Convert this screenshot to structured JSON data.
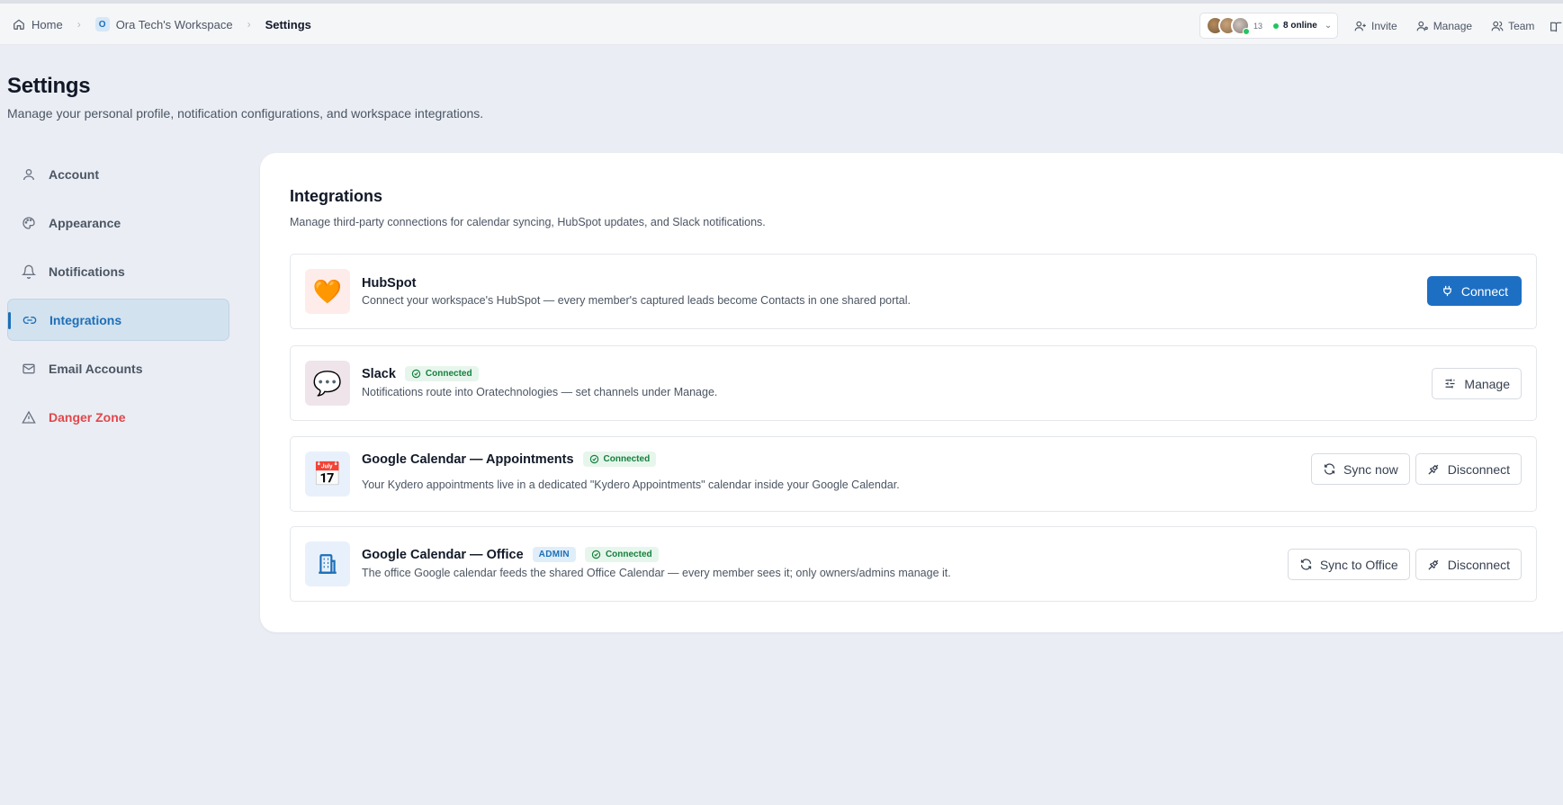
{
  "breadcrumb": {
    "home": "Home",
    "workspace_badge": "O",
    "workspace": "Ora Tech's Workspace",
    "current": "Settings"
  },
  "presence": {
    "count": "13",
    "online": "8 online"
  },
  "topbar": {
    "invite": "Invite",
    "manage": "Manage",
    "team": "Team"
  },
  "page": {
    "title": "Settings",
    "subtitle": "Manage your personal profile, notification configurations, and workspace integrations."
  },
  "sidebar": {
    "items": [
      {
        "label": "Account",
        "icon": "user-icon"
      },
      {
        "label": "Appearance",
        "icon": "palette-icon"
      },
      {
        "label": "Notifications",
        "icon": "bell-icon"
      },
      {
        "label": "Integrations",
        "icon": "link-icon",
        "active": true
      },
      {
        "label": "Email Accounts",
        "icon": "mail-icon"
      },
      {
        "label": "Danger Zone",
        "icon": "warning-icon",
        "danger": true
      }
    ]
  },
  "integrations": {
    "title": "Integrations",
    "subtitle": "Manage third-party connections for calendar syncing, HubSpot updates, and Slack notifications.",
    "cards": [
      {
        "name": "HubSpot",
        "icon": "🧡",
        "description": "Connect your workspace's HubSpot — every member's captured leads become Contacts in one shared portal.",
        "actions": [
          "Connect"
        ]
      },
      {
        "name": "Slack",
        "icon": "💬",
        "badge": "Connected",
        "description": "Notifications route into Oratechnologies — set channels under Manage.",
        "actions": [
          "Manage"
        ]
      },
      {
        "name": "Google Calendar — Appointments",
        "icon": "📅",
        "badge": "Connected",
        "description": "Your Kydero appointments live in a dedicated \"Kydero Appointments\" calendar inside your Google Calendar.",
        "actions": [
          "Sync now",
          "Disconnect"
        ]
      },
      {
        "name": "Google Calendar — Office",
        "icon": "building-icon",
        "admin_badge": "ADMIN",
        "badge": "Connected",
        "description": "The office Google calendar feeds the shared Office Calendar — every member sees it; only owners/admins manage it.",
        "actions": [
          "Sync to Office",
          "Disconnect"
        ]
      }
    ]
  },
  "colors": {
    "accent": "#1d6fc3",
    "active_nav_bg": "#d2e2ef",
    "danger": "#e0474c",
    "connected_green": "#15803d",
    "page_bg": "#eaeef4"
  }
}
